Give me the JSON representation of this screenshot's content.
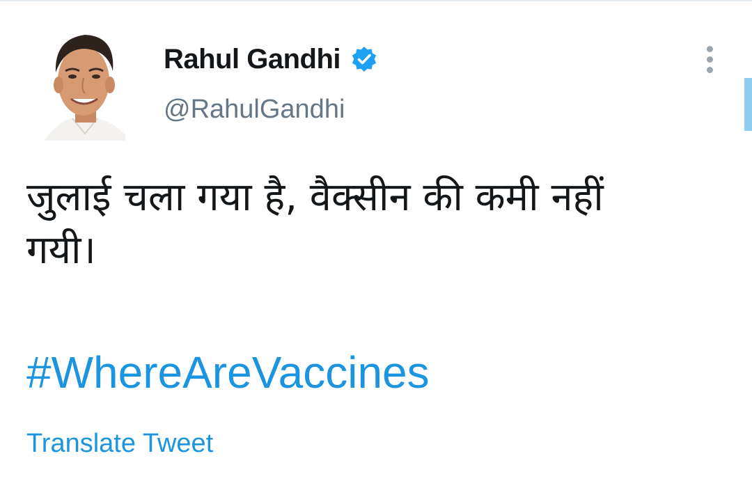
{
  "tweet": {
    "author": {
      "display_name": "Rahul Gandhi",
      "handle": "@RahulGandhi",
      "verified": true,
      "avatar_icon": "profile-photo"
    },
    "text_line_1": "जुलाई चला गया है, वैक्सीन की कमी नहीं",
    "text_line_2": "गयी।",
    "hashtag": "#WhereAreVaccines",
    "translate_label": "Translate Tweet"
  },
  "icons": {
    "verified": "verified-badge-icon",
    "more": "more-options-icon"
  },
  "colors": {
    "text": "#14171a",
    "secondary": "#657786",
    "link": "#1b95e0",
    "verified": "#1da1f2",
    "scroll_indicator": "#8ecdf0",
    "background": "#ffffff"
  }
}
